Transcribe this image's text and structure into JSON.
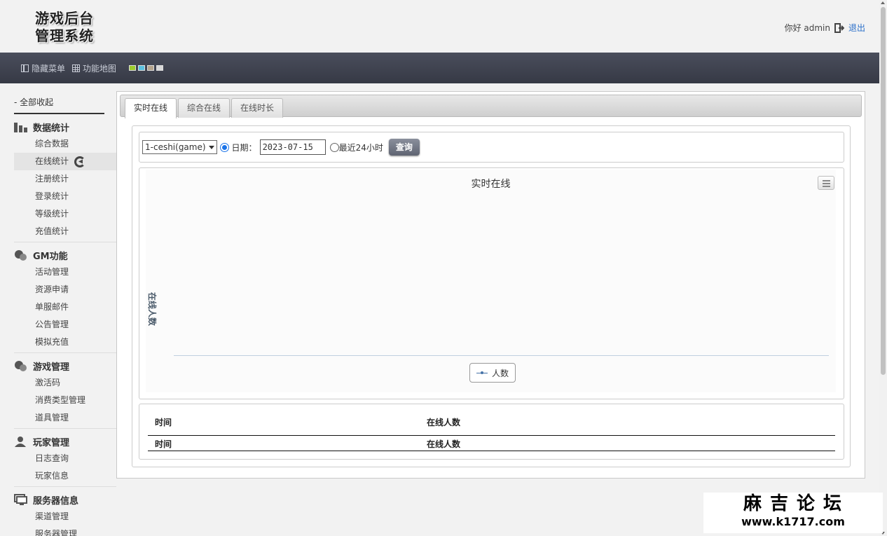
{
  "header": {
    "logo_line1": "游戏后台",
    "logo_line2": "管理系统",
    "greeting": "你好 admin",
    "logout": "退出"
  },
  "navbar": {
    "hide_menu": "隐藏菜单",
    "function_map": "功能地图",
    "theme_colors": [
      "#9ccc2c",
      "#5bc0de",
      "#b4a48c",
      "#d8d8d8"
    ]
  },
  "sidebar": {
    "collapse_all": "- 全部收起",
    "groups": [
      {
        "title": "数据统计",
        "icon": "bar-chart-icon",
        "items": [
          "综合数据",
          "在线统计",
          "注册统计",
          "登录统计",
          "等级统计",
          "充值统计"
        ],
        "active": "在线统计"
      },
      {
        "title": "GM功能",
        "icon": "gm-icon",
        "items": [
          "活动管理",
          "资源申请",
          "单服邮件",
          "公告管理",
          "模拟充值"
        ]
      },
      {
        "title": "游戏管理",
        "icon": "game-icon",
        "items": [
          "激活码",
          "消费类型管理",
          "道具管理"
        ]
      },
      {
        "title": "玩家管理",
        "icon": "user-icon",
        "items": [
          "日志查询",
          "玩家信息"
        ]
      },
      {
        "title": "服务器信息",
        "icon": "monitor-icon",
        "items": [
          "渠道管理",
          "服务器管理"
        ]
      }
    ]
  },
  "tabs": [
    "实时在线",
    "综合在线",
    "在线时长"
  ],
  "filter": {
    "server_select": "1-ceshi(game)",
    "date_label": "日期：",
    "date_value": "2023-07-15",
    "last24_label": "最近24小时",
    "query_button": "查询"
  },
  "chart_data": {
    "type": "line",
    "title": "实时在线",
    "ylabel": "在线人数",
    "xlabel": "",
    "series": [
      {
        "name": "人数",
        "values": []
      }
    ]
  },
  "table": {
    "headers": [
      "时间",
      "在线人数"
    ],
    "footer": [
      "时间",
      "在线人数"
    ]
  },
  "watermark": {
    "name": "麻吉论坛",
    "url": "www.k1717.com"
  }
}
